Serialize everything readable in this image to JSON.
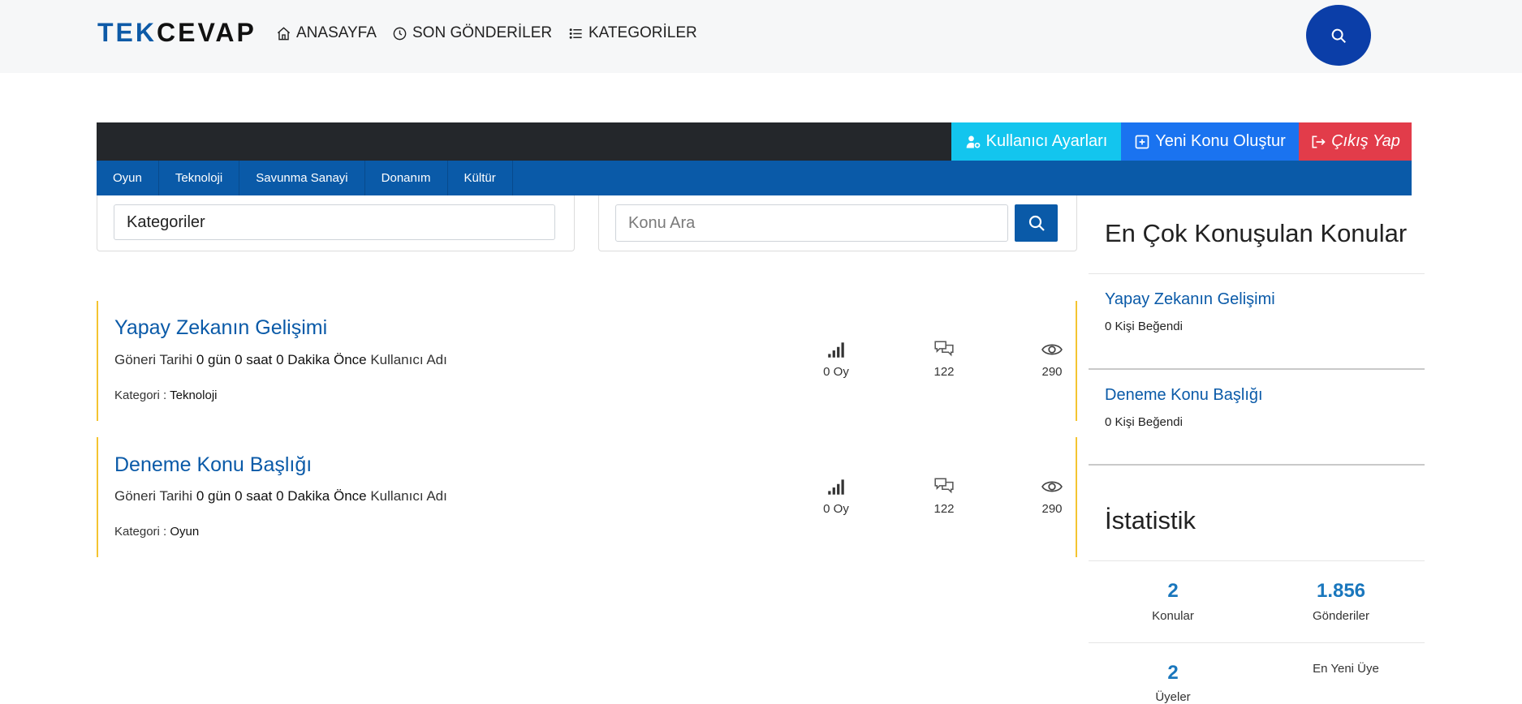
{
  "brand": {
    "part1": "TEK",
    "part2": "CEVAP"
  },
  "nav": {
    "home": "ANASAYFA",
    "recent": "SON GÖNDERİLER",
    "categories": "KATEGORİLER"
  },
  "actions": {
    "user_settings": "Kullanıcı Ayarları",
    "new_topic": "Yeni Konu Oluştur",
    "logout": "Çıkış Yap"
  },
  "category_tabs": [
    "Oyun",
    "Teknoloji",
    "Savunma Sanayi",
    "Donanım",
    "Kültür"
  ],
  "filters": {
    "category_select": "Kategoriler",
    "search_placeholder": "Konu Ara"
  },
  "topics": [
    {
      "title": "Yapay Zekanın Gelişimi",
      "date_label": "Göneri Tarihi",
      "date_value": "0 gün 0 saat 0 Dakika Önce",
      "author": "Kullanıcı Adı",
      "category_label": "Kategori :",
      "category": "Teknoloji",
      "votes": "0 Oy",
      "comments": "122",
      "views": "290"
    },
    {
      "title": "Deneme Konu Başlığı",
      "date_label": "Göneri Tarihi",
      "date_value": "0 gün 0 saat 0 Dakika Önce",
      "author": "Kullanıcı Adı",
      "category_label": "Kategori :",
      "category": "Oyun",
      "votes": "0 Oy",
      "comments": "122",
      "views": "290"
    }
  ],
  "sidebar": {
    "popular_title": "En Çok Konuşulan Konular",
    "popular": [
      {
        "title": "Yapay Zekanın Gelişimi",
        "likes": "0 Kişi Beğendi"
      },
      {
        "title": "Deneme Konu Başlığı",
        "likes": "0 Kişi Beğendi"
      }
    ],
    "stats_title": "İstatistik",
    "stats": {
      "topics_value": "2",
      "topics_label": "Konular",
      "posts_value": "1.856",
      "posts_label": "Gönderiler",
      "members_value": "2",
      "members_label": "Üyeler",
      "newest_label": "En Yeni Üye"
    }
  },
  "colors": {
    "primary": "#0a5aa8",
    "dark_bar": "#24272b",
    "info": "#13c5ee",
    "blue": "#1a73f0",
    "danger": "#e23c4a",
    "accent_border": "#f4c431",
    "search_circle": "#0b3ea8"
  }
}
